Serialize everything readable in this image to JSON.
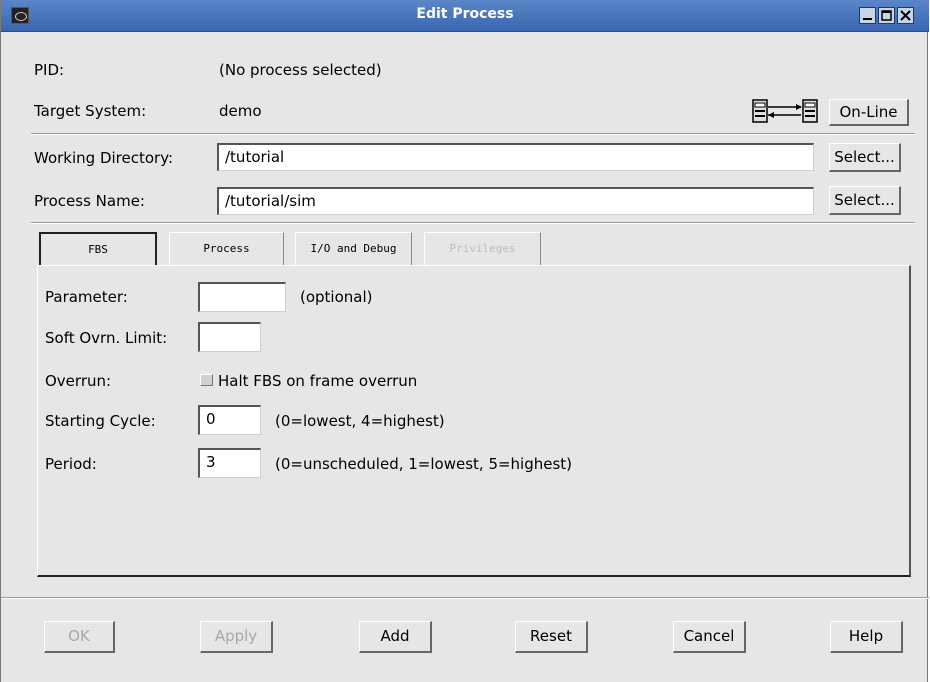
{
  "window": {
    "title": "Edit Process",
    "controls": [
      "minimize-icon",
      "maximize-icon",
      "close-icon"
    ]
  },
  "info": {
    "pid_label": "PID:",
    "pid_value": "(No process selected)",
    "target_label": "Target System:",
    "target_value": "demo",
    "online_button": "On-Line",
    "connection_icon": "network-connection-icon"
  },
  "fields": {
    "working_dir_label": "Working Directory:",
    "working_dir_value": "/tutorial",
    "working_dir_select": "Select...",
    "process_name_label": "Process Name:",
    "process_name_value": "/tutorial/sim",
    "process_name_select": "Select..."
  },
  "tabs": [
    {
      "label": "FBS",
      "state": "active"
    },
    {
      "label": "Process",
      "state": "normal"
    },
    {
      "label": "I/O and Debug",
      "state": "normal"
    },
    {
      "label": "Privileges",
      "state": "disabled"
    }
  ],
  "fbs": {
    "parameter_label": "Parameter:",
    "parameter_value": "",
    "parameter_hint": "(optional)",
    "soft_overrun_label": "Soft Ovrn. Limit:",
    "soft_overrun_value": "",
    "overrun_label": "Overrun:",
    "overrun_checkbox_label": "Halt FBS on frame overrun",
    "overrun_checked": false,
    "starting_cycle_label": "Starting Cycle:",
    "starting_cycle_value": "0",
    "starting_cycle_hint": "(0=lowest, 4=highest)",
    "period_label": "Period:",
    "period_value": "3",
    "period_hint": "(0=unscheduled, 1=lowest, 5=highest)"
  },
  "buttons": {
    "ok": "OK",
    "apply": "Apply",
    "add": "Add",
    "reset": "Reset",
    "cancel": "Cancel",
    "help": "Help"
  }
}
